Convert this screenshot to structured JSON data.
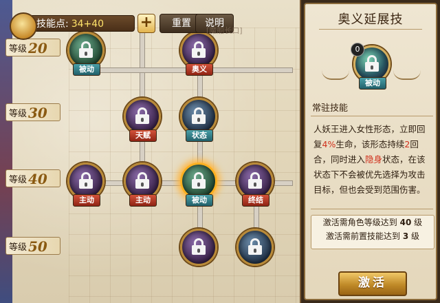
{
  "topbar": {
    "skill_points_label": "技能点:",
    "skill_points_value": "34+40",
    "plus_label": "+",
    "reset_label": "重置",
    "help_label": "说明",
    "ghost_text": "[魔船长口]"
  },
  "levels": [
    {
      "label": "等级",
      "num": "20"
    },
    {
      "label": "等级",
      "num": "30"
    },
    {
      "label": "等级",
      "num": "40"
    },
    {
      "label": "等级",
      "num": "50"
    }
  ],
  "skills": [
    {
      "tag": "被动",
      "color": "teal"
    },
    {
      "tag": "奥义",
      "color": "red"
    },
    {
      "tag": "天赋",
      "color": "red"
    },
    {
      "tag": "状态",
      "color": "teal"
    },
    {
      "tag": "主动",
      "color": "red"
    },
    {
      "tag": "主动",
      "color": "red"
    },
    {
      "tag": "被动",
      "color": "teal"
    },
    {
      "tag": "终结",
      "color": "red"
    }
  ],
  "detail": {
    "title": "奥义延展技",
    "level_badge": "0",
    "node_tag": "被动",
    "section_label": "常驻技能",
    "desc": {
      "p1": "人妖王进入女性形态，立即回复",
      "p1_red": "4%",
      "p2": "生命，该形态持续",
      "p2_red": "2",
      "p3": "回合，同时进入",
      "p3_red": "隐身",
      "p4": "状态，在该状态下不会被优先选择为攻击目标，但也会受到范围伤害。"
    },
    "req1_pre": "激活需角色等级达到",
    "req1_num": "40",
    "req1_post": "级",
    "req2_pre": "激活需前置技能达到",
    "req2_num": "3",
    "req2_post": "级",
    "activate_label": "激活"
  },
  "colors": {
    "accent_red": "#d0301c",
    "gold": "#c08a28"
  }
}
